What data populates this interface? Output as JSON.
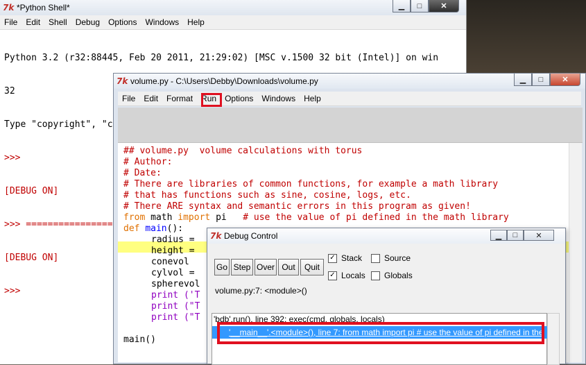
{
  "shell": {
    "title": "*Python Shell*",
    "menu": [
      "File",
      "Edit",
      "Shell",
      "Debug",
      "Options",
      "Windows",
      "Help"
    ],
    "lines": [
      {
        "text": "Python 3.2 (r32:88445, Feb 20 2011, 21:29:02) [MSC v.1500 32 bit (Intel)] on win",
        "color": "black"
      },
      {
        "text": "32",
        "color": "black"
      },
      {
        "text": "Type \"copyright\", \"credits\" or \"license()\" for more information.",
        "color": "black"
      },
      {
        "text": ">>>",
        "color": "red"
      },
      {
        "text": "[DEBUG ON]",
        "color": "red"
      },
      {
        "text": ">>> ================",
        "color": "red"
      },
      {
        "text": "[DEBUG ON]",
        "color": "red"
      },
      {
        "text": ">>>",
        "color": "red"
      }
    ]
  },
  "editor": {
    "title": "volume.py - C:\\Users\\Debby\\Downloads\\volume.py",
    "menu": [
      "File",
      "Edit",
      "Format",
      "Run",
      "Options",
      "Windows",
      "Help"
    ],
    "highlighted_menu": "Run",
    "code": {
      "l1": "## volume.py  volume calculations with torus",
      "l2": "# Author:",
      "l3": "# Date:",
      "l4": "# There are libraries of common functions, for example a math library",
      "l5": "# that has functions such as sine, cosine, logs, etc.",
      "l6": "# There ARE syntax and semantic errors in this program as given!",
      "l7_kw1": "from",
      "l7_mid": " math ",
      "l7_kw2": "import",
      "l7_rest": " pi   ",
      "l7_comment": "# use the value of pi defined in the math library",
      "l8_kw": "def",
      "l8_name": "main",
      "l8_rest": "():",
      "l9": "radius =",
      "l10": "height =",
      "l11": "conevol",
      "l12": "cylvol =",
      "l13": "spherevol",
      "l14": "print ('T",
      "l15": "print (\"T",
      "l16": "print (\"T",
      "l17": "main()"
    }
  },
  "debug": {
    "title": "Debug Control",
    "buttons": [
      "Go",
      "Step",
      "Over",
      "Out",
      "Quit"
    ],
    "checks": {
      "stack": {
        "label": "Stack",
        "checked": true
      },
      "source": {
        "label": "Source",
        "checked": false
      },
      "locals": {
        "label": "Locals",
        "checked": true
      },
      "globals": {
        "label": "Globals",
        "checked": false
      }
    },
    "status": "volume.py:7: <module>()",
    "stack_rows": [
      "'bdb'.run(), line 392: exec(cmd, globals, locals)",
      "'__main__'.<module>(), line 7: from math import pi   # use the value of pi defined in the"
    ]
  }
}
